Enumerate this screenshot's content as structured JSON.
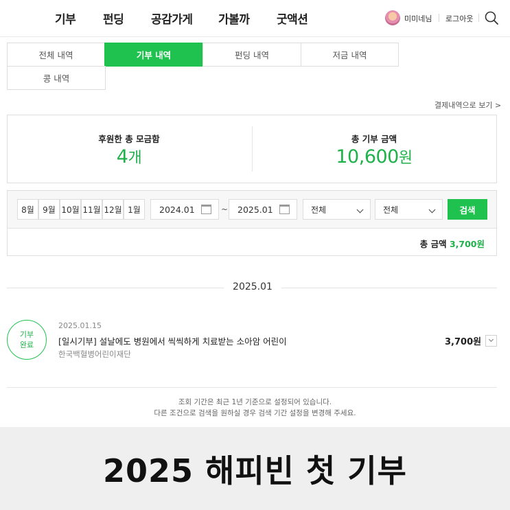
{
  "nav": {
    "menu": [
      "기부",
      "펀딩",
      "공감가게",
      "가볼까",
      "굿액션"
    ],
    "nickname": "미미네님",
    "logout": "로그아웃"
  },
  "tabs": [
    {
      "label": "전체 내역",
      "active": false
    },
    {
      "label": "기부 내역",
      "active": true
    },
    {
      "label": "펀딩 내역",
      "active": false
    },
    {
      "label": "저금 내역",
      "active": false
    },
    {
      "label": "콩 내역",
      "active": false
    }
  ],
  "receipt_link": "결제내역으로 보기 >",
  "summary": {
    "boxes_label": "후원한 총 모금함",
    "boxes_value": "4",
    "boxes_unit": "개",
    "amount_label": "총 기부 금액",
    "amount_value": "10,600",
    "amount_unit": "원"
  },
  "filter": {
    "months": [
      "8월",
      "9월",
      "10월",
      "11월",
      "12월",
      "1월"
    ],
    "date_from": "2024.01",
    "tilde": "~",
    "date_to": "2025.01",
    "select1": "전체",
    "select2": "전체",
    "search_button": "검색",
    "total_label": "총 금액",
    "total_amount": "3,700원"
  },
  "month_header": "2025.01",
  "item": {
    "badge_line1": "기부",
    "badge_line2": "완료",
    "date": "2025.01.15",
    "title": "[일시기부] 설날에도 병원에서 씩씩하게 치료받는 소아암 어린이",
    "org": "한국백혈병어린이재단",
    "amount": "3,700원"
  },
  "notice": {
    "line1": "조회 기간은 최근 1년 기준으로 설정되어 있습니다.",
    "line2": "다른 조건으로 검색을 원하실 경우 검색 기간 설정을 변경해 주세요."
  },
  "caption": "2025 해피빈 첫 기부",
  "colors": {
    "accent": "#1fc24f",
    "accent_text": "#1fb14a"
  }
}
